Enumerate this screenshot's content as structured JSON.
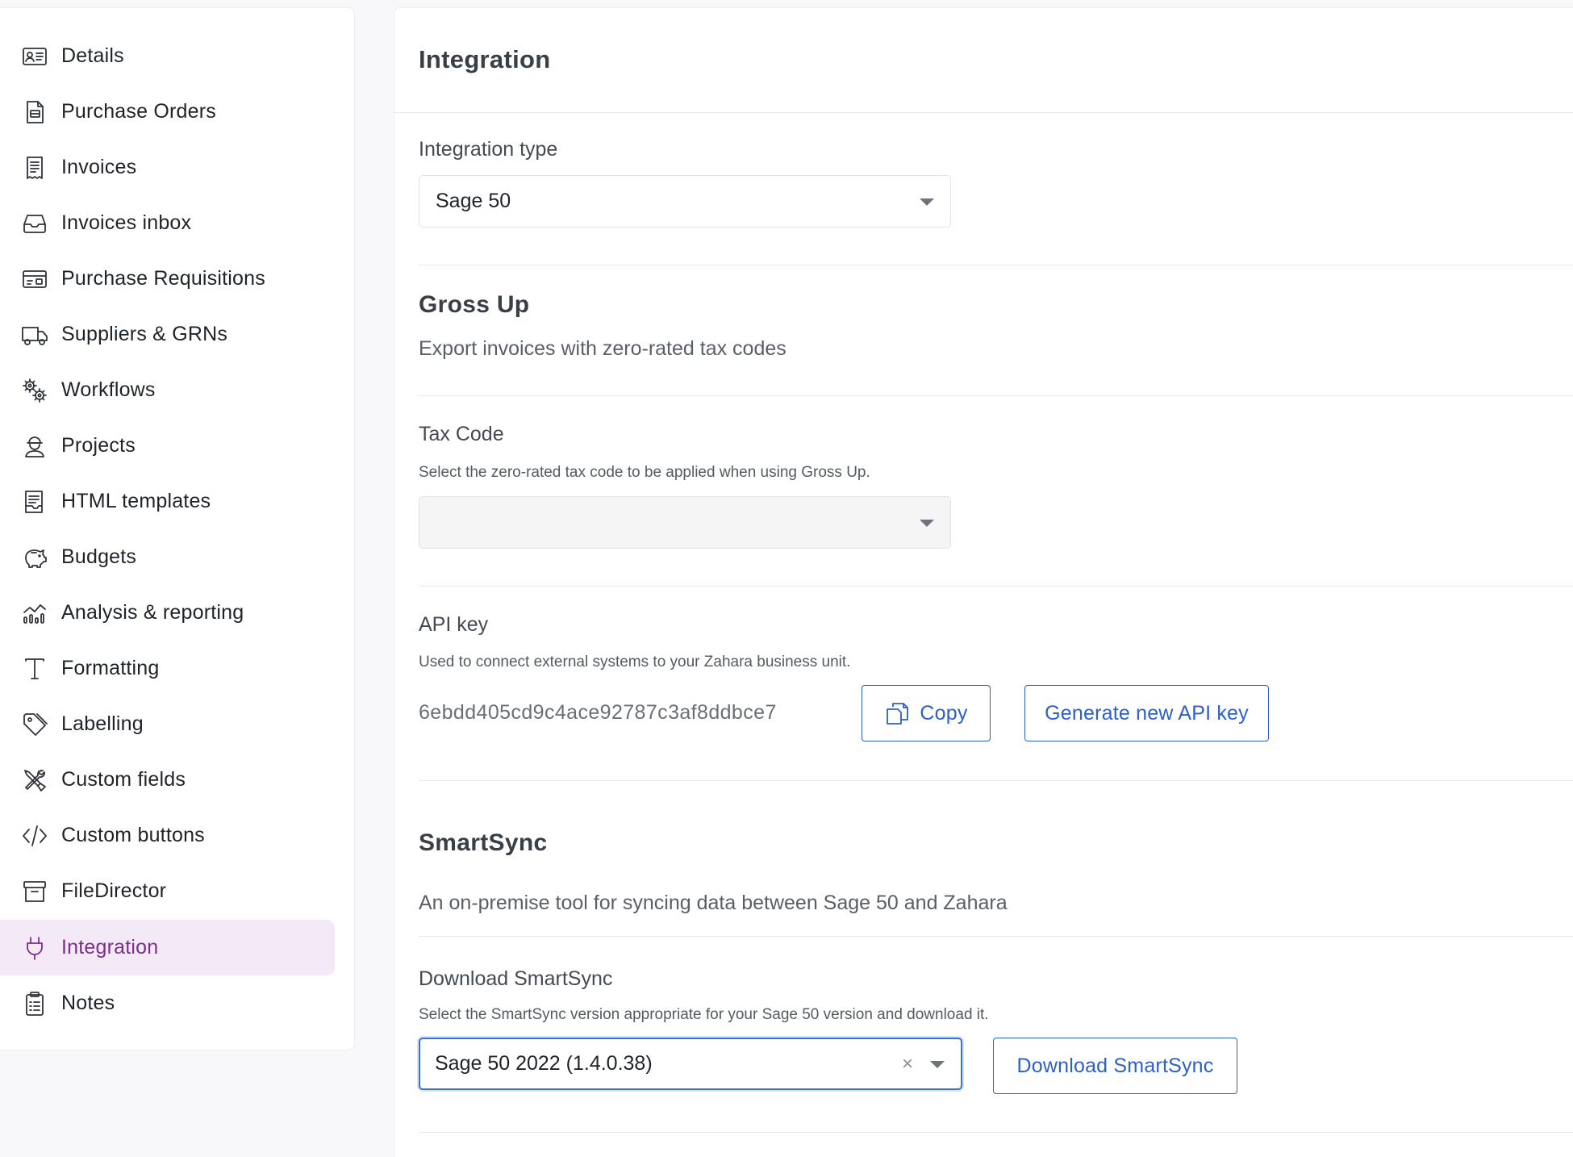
{
  "sidebar": {
    "items": [
      {
        "label": "Details",
        "icon": "id-card-icon"
      },
      {
        "label": "Purchase Orders",
        "icon": "document-icon"
      },
      {
        "label": "Invoices",
        "icon": "receipt-icon"
      },
      {
        "label": "Invoices inbox",
        "icon": "inbox-icon"
      },
      {
        "label": "Purchase Requisitions",
        "icon": "requisition-card-icon"
      },
      {
        "label": "Suppliers & GRNs",
        "icon": "truck-icon"
      },
      {
        "label": "Workflows",
        "icon": "gears-icon"
      },
      {
        "label": "Projects",
        "icon": "worker-icon"
      },
      {
        "label": "HTML templates",
        "icon": "template-icon"
      },
      {
        "label": "Budgets",
        "icon": "piggy-bank-icon"
      },
      {
        "label": "Analysis & reporting",
        "icon": "chart-icon"
      },
      {
        "label": "Formatting",
        "icon": "text-format-icon"
      },
      {
        "label": "Labelling",
        "icon": "tag-icon"
      },
      {
        "label": "Custom fields",
        "icon": "tools-icon"
      },
      {
        "label": "Custom buttons",
        "icon": "code-icon"
      },
      {
        "label": "FileDirector",
        "icon": "archive-box-icon"
      },
      {
        "label": "Integration",
        "icon": "plug-icon"
      },
      {
        "label": "Notes",
        "icon": "clipboard-icon"
      }
    ],
    "active_label": "Integration",
    "active_color": "#7a2f8a",
    "active_bg": "#f4e9f6"
  },
  "main": {
    "title": "Integration",
    "integration_type": {
      "label": "Integration type",
      "value": "Sage 50"
    },
    "gross_up": {
      "title": "Gross Up",
      "description": "Export invoices with zero-rated tax codes"
    },
    "tax_code": {
      "label": "Tax Code",
      "help": "Select the zero-rated tax code to be applied when using Gross Up.",
      "value": ""
    },
    "api_key": {
      "label": "API key",
      "help": "Used to connect external systems to your Zahara business unit.",
      "value": "6ebdd405cd9c4ace92787c3af8ddbce7",
      "copy_label": "Copy",
      "generate_label": "Generate new API key"
    },
    "smartsync": {
      "title": "SmartSync",
      "description": "An on-premise tool for syncing data between Sage 50 and Zahara",
      "download_label": "Download SmartSync",
      "download_help": "Select the SmartSync version appropriate for your Sage 50 version and download it.",
      "version_value": "Sage 50 2022 (1.4.0.38)",
      "clear_glyph": "×",
      "download_button_label": "Download SmartSync"
    }
  },
  "colors": {
    "accent_blue": "#2d5fc9",
    "focus_blue": "#3a6fd8"
  }
}
